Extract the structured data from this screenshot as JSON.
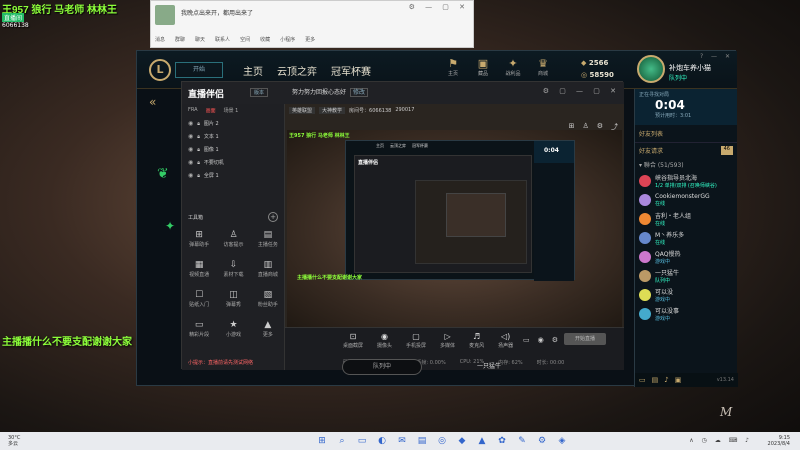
{
  "overlay": {
    "title": "王957 狼行 马老师 林林王",
    "sub": "直播间",
    "id": "6066138",
    "left_msg": "主播播什么不要支配谢谢大家"
  },
  "chat_window": {
    "message": "我晚点出来开，都用出来了",
    "tabs": [
      "消息",
      "群聊",
      "聊天",
      "联系人",
      "空间",
      "收藏",
      "小程序",
      "更多"
    ]
  },
  "lol": {
    "logo": "L",
    "play_label": "开始",
    "nav": [
      "主页",
      "云顶之弈",
      "冠军杯赛"
    ],
    "icons": [
      {
        "glyph": "⚑",
        "label": "主页"
      },
      {
        "glyph": "▣",
        "label": "藏品"
      },
      {
        "glyph": "✦",
        "label": "战利品"
      },
      {
        "glyph": "♛",
        "label": "商城"
      }
    ],
    "currency_be": "2566",
    "currency_rp": "58590",
    "profile_name": "补炮车养小猫",
    "profile_status": "队列中",
    "queue_line": "正在寻找对局",
    "queue_timer": "0:04",
    "queue_sub": "预计用时：3:01",
    "friends_header": "好友列表",
    "friend_requests": "好友请求",
    "friend_requests_count": "46",
    "group_label": "▾ 聯合 (51/593)",
    "friends": [
      {
        "name": "峡谷指导员北海",
        "status": "1/2 单排/双排 (召唤师峡谷)",
        "color": "#d45"
      },
      {
        "name": "CookiemonsterGG",
        "status": "在线",
        "color": "#a8d"
      },
      {
        "name": "吉利・老人组",
        "status": "在线",
        "color": "#e83"
      },
      {
        "name": "M丶养乐多",
        "status": "在线",
        "color": "#68c"
      },
      {
        "name": "QAQ慢热",
        "status": "游戏中",
        "color": "#c7c"
      },
      {
        "name": "一只猛牛",
        "status": "队列中",
        "color": "#b96"
      },
      {
        "name": "可以没",
        "status": "游戏中",
        "color": "#dd5"
      },
      {
        "name": "可以没事",
        "status": "游戏中",
        "color": "#4ac"
      }
    ],
    "version": "v13.14",
    "queue_button": "队列中",
    "queue_user": "一只猛牛"
  },
  "streamer": {
    "logo": "直播伴侣",
    "logo_badge": "版本",
    "channel": "努力努力回报心态好",
    "channel_tag": "修改",
    "meta": [
      "英雄联盟",
      "大神教学",
      "房间号：6066138",
      "290017"
    ],
    "tabs": [
      "FRA",
      "画面",
      "场景 1"
    ],
    "layers": [
      "图片 2",
      "文本 1",
      "图像 1",
      "不要切机",
      "全屏 1"
    ],
    "tools_header": "工具箱",
    "tools": [
      {
        "glyph": "⊞",
        "label": "弹幕助手"
      },
      {
        "glyph": "♙",
        "label": "访客提示"
      },
      {
        "glyph": "▤",
        "label": "主播任务"
      },
      {
        "glyph": "▦",
        "label": "视频直通"
      },
      {
        "glyph": "⇩",
        "label": "素材下载"
      },
      {
        "glyph": "▥",
        "label": "直播商城"
      },
      {
        "glyph": "☐",
        "label": "贴纸入门"
      },
      {
        "glyph": "◫",
        "label": "弹幕秀"
      },
      {
        "glyph": "▧",
        "label": "粉丝助手"
      },
      {
        "glyph": "▭",
        "label": "精彩片段"
      },
      {
        "glyph": "★",
        "label": "小游戏"
      },
      {
        "glyph": "▲",
        "label": "更多"
      }
    ],
    "left_footer": "小提示：直播前请先测试网络",
    "inner_msg": "主播播什么不要支配谢谢大家",
    "inner_ticker": "王957 狼行 马老师 林林王",
    "inner_nav": [
      "主页",
      "云顶之弈",
      "冠军杯赛"
    ],
    "inner_timer": "0:04",
    "controls": [
      {
        "glyph": "⊡",
        "label": "桌面截屏"
      },
      {
        "glyph": "◉",
        "label": "摄像头"
      },
      {
        "glyph": "▢",
        "label": "手机投屏"
      },
      {
        "glyph": "▷",
        "label": "多媒体"
      },
      {
        "glyph": "♬",
        "label": "麦克风"
      },
      {
        "glyph": "◁)",
        "label": "扬声器"
      }
    ],
    "golive": "开始直播",
    "stats": [
      "码率: 0kb/s",
      "FPS: 60",
      "丢帧: 0.00%",
      "CPU: 21%",
      "内存: 62%",
      "时长: 00:00"
    ]
  },
  "taskbar": {
    "weather_temp": "30°C",
    "weather_desc": "多云",
    "icons": [
      "⊞",
      "⌕",
      "▭",
      "◐",
      "✉",
      "▤",
      "◎",
      "◆",
      "▲",
      "✿",
      "✎",
      "⚙",
      "◈"
    ],
    "time": "9:15",
    "date": "2023/8/4",
    "tray": "∧ ◷ ☁ ⌨ ♪"
  },
  "watermark": "M"
}
